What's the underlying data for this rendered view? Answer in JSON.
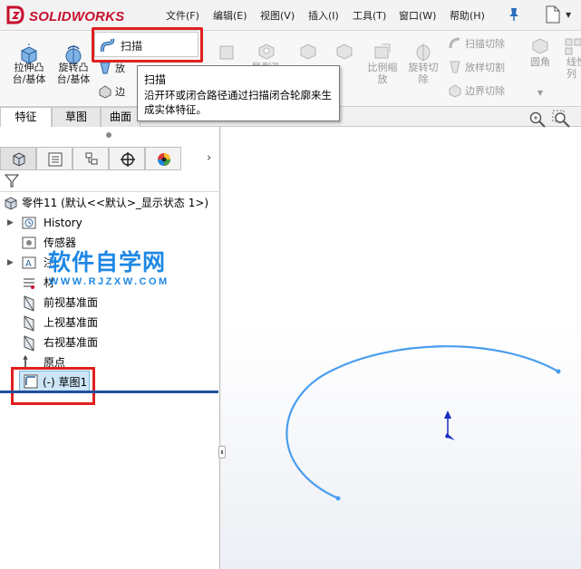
{
  "app": {
    "name": "SOLIDWORKS"
  },
  "menu": [
    "文件(F)",
    "编辑(E)",
    "视图(V)",
    "插入(I)",
    "工具(T)",
    "窗口(W)",
    "帮助(H)"
  ],
  "ribbon": {
    "extrude_boss": "拉伸凸\n台/基体",
    "revolve_boss": "旋转凸\n台/基体",
    "sweep": "扫描",
    "loft_partial": "放",
    "boundary_partial": "边",
    "hole_wizard_partial": "异型孔",
    "scale": "比例缩\n放",
    "revolve_cut": "旋转切\n除",
    "sweep_cut": "扫描切除",
    "loft_cut": "放样切割",
    "boundary_cut": "边界切除",
    "fillet": "圆角",
    "linear_pattern_partial": "线性\n列"
  },
  "tooltip": {
    "title": "扫描",
    "description": "沿开环或闭合路径通过扫描闭合轮廓来生成实体特征。"
  },
  "tabs": [
    "特征",
    "草图",
    "曲面"
  ],
  "tree": {
    "root": "零件11  (默认<<默认>_显示状态 1>)",
    "items": [
      "History",
      "传感器",
      "注",
      "材",
      "前视基准面",
      "上视基准面",
      "右视基准面",
      "原点",
      "(-) 草图1"
    ]
  },
  "watermark": {
    "main": "软件自学网",
    "sub": "WWW.RJZXW.COM"
  },
  "colors": {
    "accent_red": "#e02020",
    "sketch_blue": "#4a9ef0",
    "brand_red": "#c8102e"
  }
}
